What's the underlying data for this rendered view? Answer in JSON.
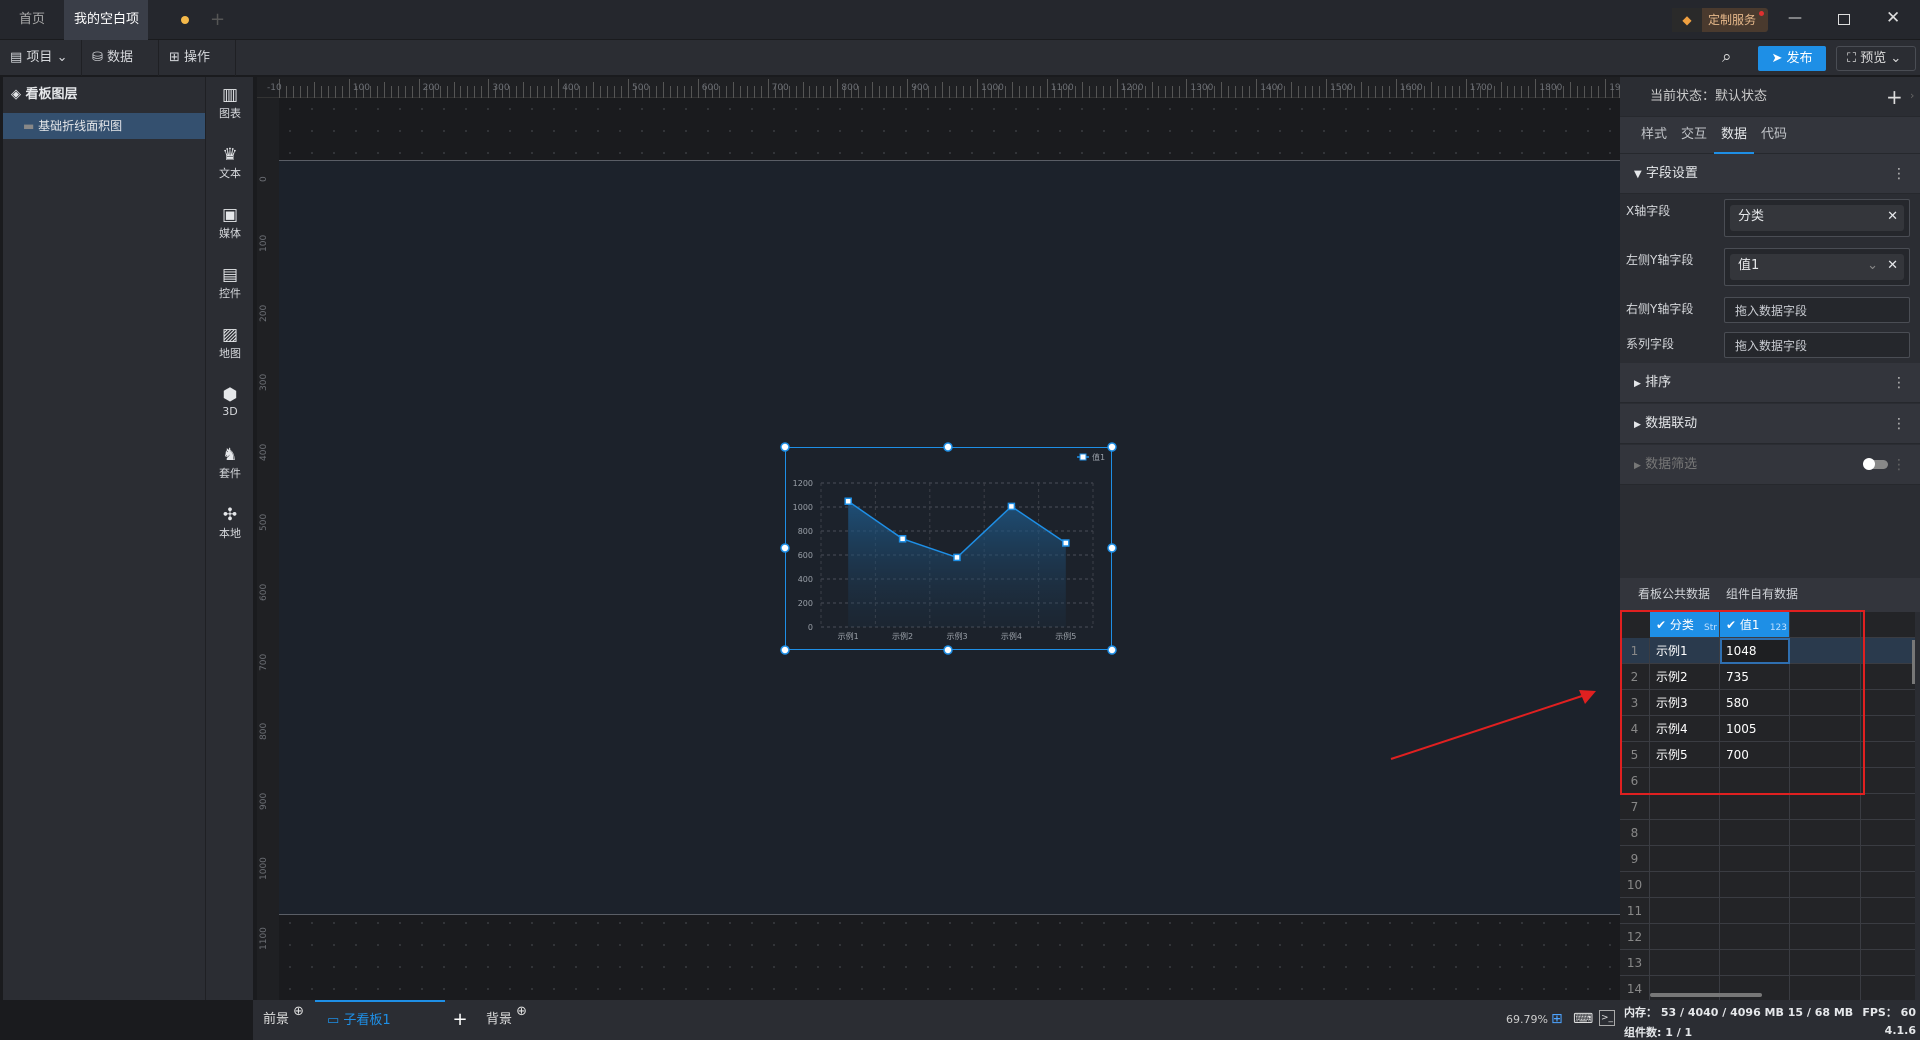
{
  "titlebar": {
    "tabs": [
      {
        "label": "首页"
      },
      {
        "label": "我的空白项目"
      }
    ],
    "add_tab": "+",
    "custom_service": "定制服务"
  },
  "toolbar": {
    "project": "项目",
    "data": "数据",
    "operate": "操作",
    "publish": "发布",
    "preview": "预览"
  },
  "layers": {
    "title": "看板图层",
    "items": [
      {
        "label": "基础折线面积图"
      }
    ]
  },
  "iconbar": [
    {
      "label": "图表",
      "icon": "bar-chart-icon"
    },
    {
      "label": "文本",
      "icon": "text-icon"
    },
    {
      "label": "媒体",
      "icon": "media-icon"
    },
    {
      "label": "控件",
      "icon": "widget-icon"
    },
    {
      "label": "地图",
      "icon": "map-icon"
    },
    {
      "label": "3D",
      "icon": "cube-icon"
    },
    {
      "label": "套件",
      "icon": "kit-icon"
    },
    {
      "label": "本地",
      "icon": "puzzle-icon"
    }
  ],
  "ruler": {
    "h_labels": [
      "-10",
      "100",
      "200",
      "300",
      "400",
      "500",
      "600",
      "700",
      "800",
      "900",
      "1000",
      "1100",
      "1200",
      "1300",
      "1400",
      "1500",
      "1600",
      "1700",
      "1800",
      "1900"
    ],
    "v_labels": [
      "0",
      "100",
      "200",
      "300",
      "400",
      "500",
      "600",
      "700",
      "800",
      "900",
      "1000",
      "1100"
    ]
  },
  "chart_data": {
    "type": "area",
    "categories": [
      "示例1",
      "示例2",
      "示例3",
      "示例4",
      "示例5"
    ],
    "series": [
      {
        "name": "值1",
        "values": [
          1048,
          735,
          580,
          1005,
          700
        ]
      }
    ],
    "ylim": [
      0,
      1200
    ],
    "yticks": [
      "0",
      "200",
      "400",
      "600",
      "800",
      "1000",
      "1200"
    ],
    "grid": true,
    "legend": "top-right",
    "color": "#1e8fe6"
  },
  "bottom": {
    "foreground": "前景",
    "subboard": "子看板1",
    "add": "+",
    "background": "背景",
    "zoom": "69.79%"
  },
  "right": {
    "state_label": "当前状态：",
    "state_value": "默认状态",
    "tabs": [
      "样式",
      "交互",
      "数据",
      "代码"
    ],
    "active_tab": "数据",
    "field_section": "字段设置",
    "x_field_label": "X轴字段",
    "x_field_value": "分类",
    "left_y_label": "左侧Y轴字段",
    "left_y_value": "值1",
    "right_y_label": "右侧Y轴字段",
    "right_y_placeholder": "拖入数据字段",
    "series_label": "系列字段",
    "series_placeholder": "拖入数据字段",
    "sort": "排序",
    "linkage": "数据联动",
    "filter": "数据筛选",
    "data_tabs": [
      "看板公共数据",
      "组件自有数据"
    ],
    "columns": [
      {
        "name": "分类",
        "type": "Str"
      },
      {
        "name": "值1",
        "type": "123"
      }
    ],
    "rows": [
      [
        "示例1",
        "1048"
      ],
      [
        "示例2",
        "735"
      ],
      [
        "示例3",
        "580"
      ],
      [
        "示例4",
        "1005"
      ],
      [
        "示例5",
        "700"
      ]
    ],
    "row_numbers": [
      "1",
      "2",
      "3",
      "4",
      "5",
      "6",
      "7",
      "8",
      "9",
      "10",
      "11",
      "12",
      "13",
      "14"
    ]
  },
  "status": {
    "memory": "内存：  53 / 4040 / 4096 MB  15 / 68 MB",
    "fps": "FPS：  60",
    "components": "组件数: 1 / 1",
    "version": "4.1.6"
  },
  "accent": "#1e8fe6",
  "annotation_color": "#e02020"
}
